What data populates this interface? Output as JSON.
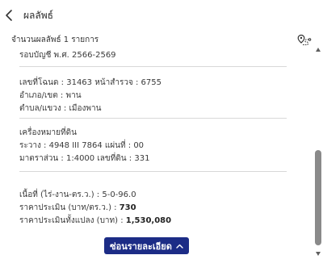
{
  "header": {
    "title": "ผลลัพธ์"
  },
  "results": {
    "count_label": "จำนวนผลลัพธ์ 1 รายการ"
  },
  "parcel": {
    "year_row": "รอบบัญชี พ.ศ. 2566-2569",
    "deed_row": "เลขที่โฉนด : 31463 หน้าสำรวจ : 6755",
    "district_row": "อำเภอ/เขต : พาน",
    "subdistrict_row": "ตำบล/แขวง : เมืองพาน",
    "marker_heading": "เครื่องหมายที่ดิน",
    "sheet_row": "ระวาง : 4948 III 7864 แผ่นที่ : 00",
    "scale_row": "มาตราส่วน : 1:4000 เลขที่ดิน : 331",
    "area_row": "เนื้อที่ (ไร่-งาน-ตร.ว.) : 5-0-96.0",
    "price_label": "ราคาประเมิน (บาท/ตร.ว.) : ",
    "price_value": "730",
    "total_label": "ราคาประเมินทั้งแปลง (บาท) : ",
    "total_value": "1,530,080"
  },
  "collapse_button": {
    "label": "ซ่อนรายละเอียด"
  },
  "icons": {
    "back": "chevron-left-icon",
    "map": "map-pin-route-icon",
    "collapse": "chevron-up-icon"
  },
  "colors": {
    "button_bg": "#1c2c86",
    "scroll_thumb": "#8a8a8a"
  }
}
